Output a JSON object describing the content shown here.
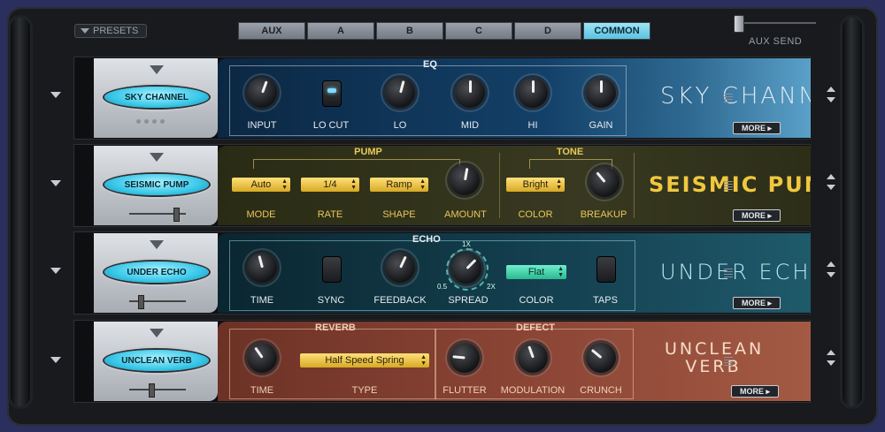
{
  "header": {
    "presets_label": "PRESETS",
    "tabs": [
      {
        "label": "AUX",
        "active": false
      },
      {
        "label": "A",
        "active": false
      },
      {
        "label": "B",
        "active": false
      },
      {
        "label": "C",
        "active": false
      },
      {
        "label": "D",
        "active": false
      },
      {
        "label": "COMMON",
        "active": true
      }
    ],
    "aux_send_label": "AUX SEND"
  },
  "rows": {
    "sky": {
      "pill_label": "SKY CHANNEL",
      "section_title": "EQ",
      "labels": [
        "INPUT",
        "LO CUT",
        "LO",
        "MID",
        "HI",
        "GAIN"
      ],
      "lo_cut_on": true,
      "name": "SKY CHANNEL",
      "more": "MORE ▸"
    },
    "pump": {
      "pill_label": "SEISMIC PUMP",
      "section_pump": "PUMP",
      "section_tone": "TONE",
      "mode_value": "Auto",
      "rate_value": "1/4",
      "shape_value": "Ramp",
      "color_value": "Bright",
      "labels": [
        "MODE",
        "RATE",
        "SHAPE",
        "AMOUNT",
        "COLOR",
        "BREAKUP"
      ],
      "name": "SEISMIC PUMP",
      "more": "MORE ▸"
    },
    "echo": {
      "pill_label": "UNDER ECHO",
      "section_title": "ECHO",
      "color_value": "Flat",
      "spread_ticks": [
        "1X",
        "0.5",
        "2X"
      ],
      "labels": [
        "TIME",
        "SYNC",
        "FEEDBACK",
        "SPREAD",
        "COLOR",
        "TAPS"
      ],
      "name": "UNDER ECHO",
      "more": "MORE ▸"
    },
    "verb": {
      "pill_label": "UNCLEAN VERB",
      "section_reverb": "REVERB",
      "section_defect": "DEFECT",
      "type_value": "Half Speed Spring",
      "labels": [
        "TIME",
        "TYPE",
        "FLUTTER",
        "MODULATION",
        "CRUNCH"
      ],
      "name_line1": "UNCLEAN",
      "name_line2": "VERB",
      "more": "MORE ▸"
    }
  },
  "colors": {
    "accent_cyan": "#59c3e0",
    "pump_yellow": "#e8c85a",
    "echo_teal": "#29b890"
  }
}
